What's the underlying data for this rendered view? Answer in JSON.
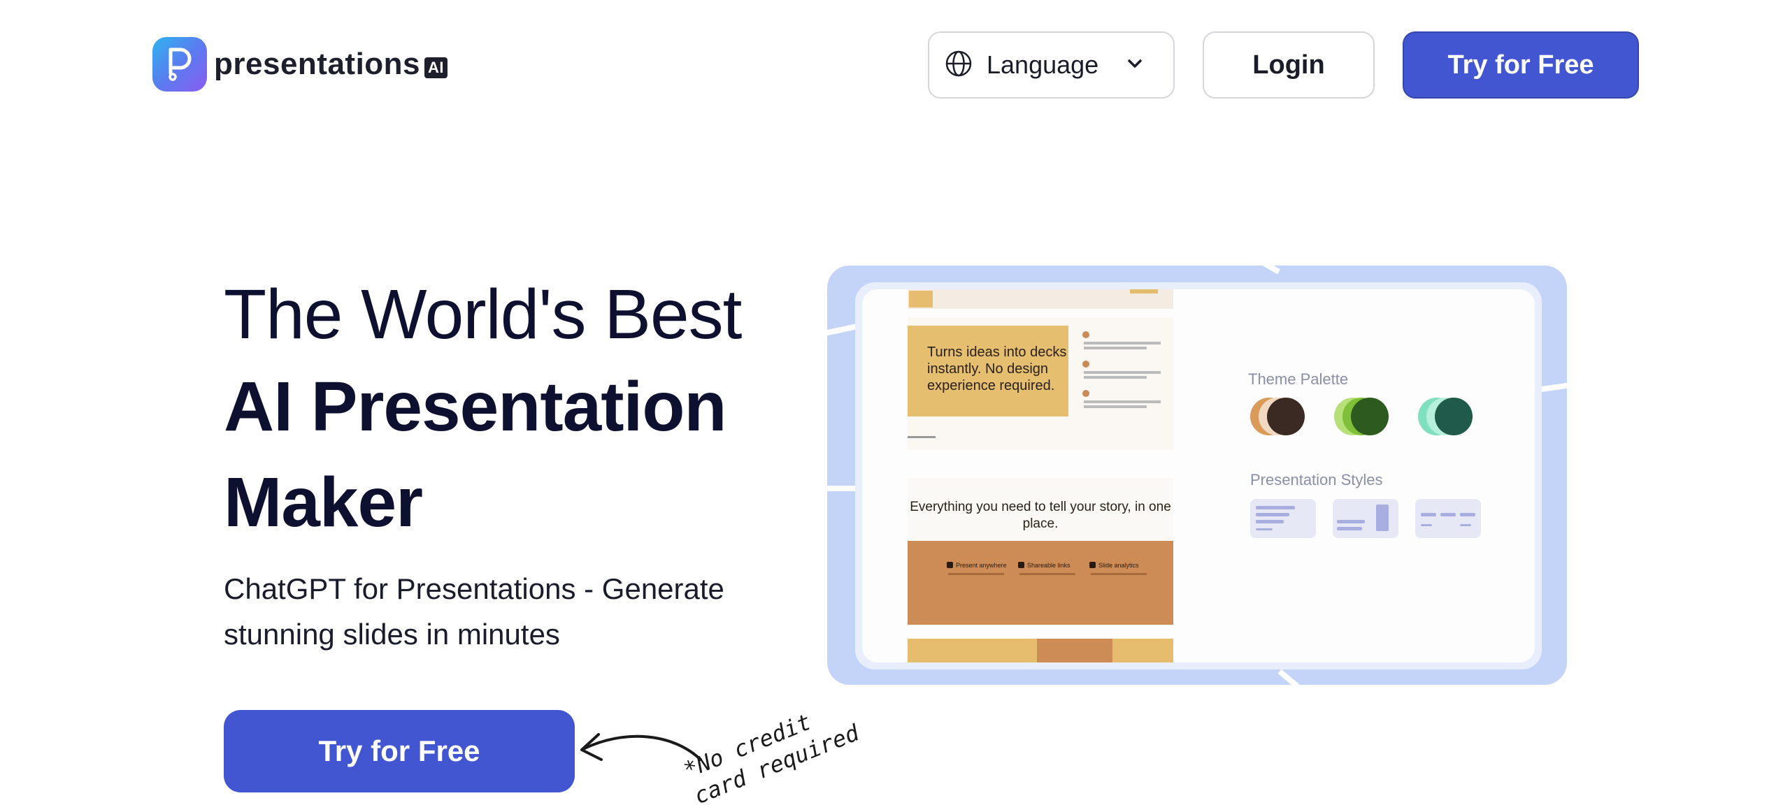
{
  "header": {
    "logo_text": "presentations",
    "logo_badge": "AI",
    "language_label": "Language",
    "login_label": "Login",
    "cta_label": "Try for Free"
  },
  "hero": {
    "title_line1": "The World's Best",
    "title_line2": "AI Presentation",
    "title_line3": "Maker",
    "subtitle": "ChatGPT for Presentations - Generate stunning slides in minutes",
    "cta_label": "Try for Free",
    "note": "*No credit\ncard required"
  },
  "preview": {
    "slide1_text": "Turns ideas into decks instantly. No design experience required.",
    "slide2_text": "Everything you need to tell your story, in one place.",
    "slide2_features": [
      "Present anywhere",
      "Shareable links",
      "Slide analytics"
    ],
    "theme_palette_label": "Theme Palette",
    "presentation_styles_label": "Presentation Styles",
    "palettes": [
      [
        "#d99a5a",
        "#f0d9c0",
        "#3b2a24"
      ],
      [
        "#b8e07a",
        "#7fbf3a",
        "#2d5a1e"
      ],
      [
        "#7fe0c0",
        "#b6f0dc",
        "#1f5a4a"
      ]
    ]
  },
  "colors": {
    "brand": "#4356d2",
    "heading": "#0e1030",
    "preview_bg": "#c4d4f8"
  },
  "icons": {
    "logo": "presentations-logo-icon",
    "language": "globe-icon",
    "dropdown": "chevron-down-icon",
    "arrow": "curved-arrow-icon"
  }
}
